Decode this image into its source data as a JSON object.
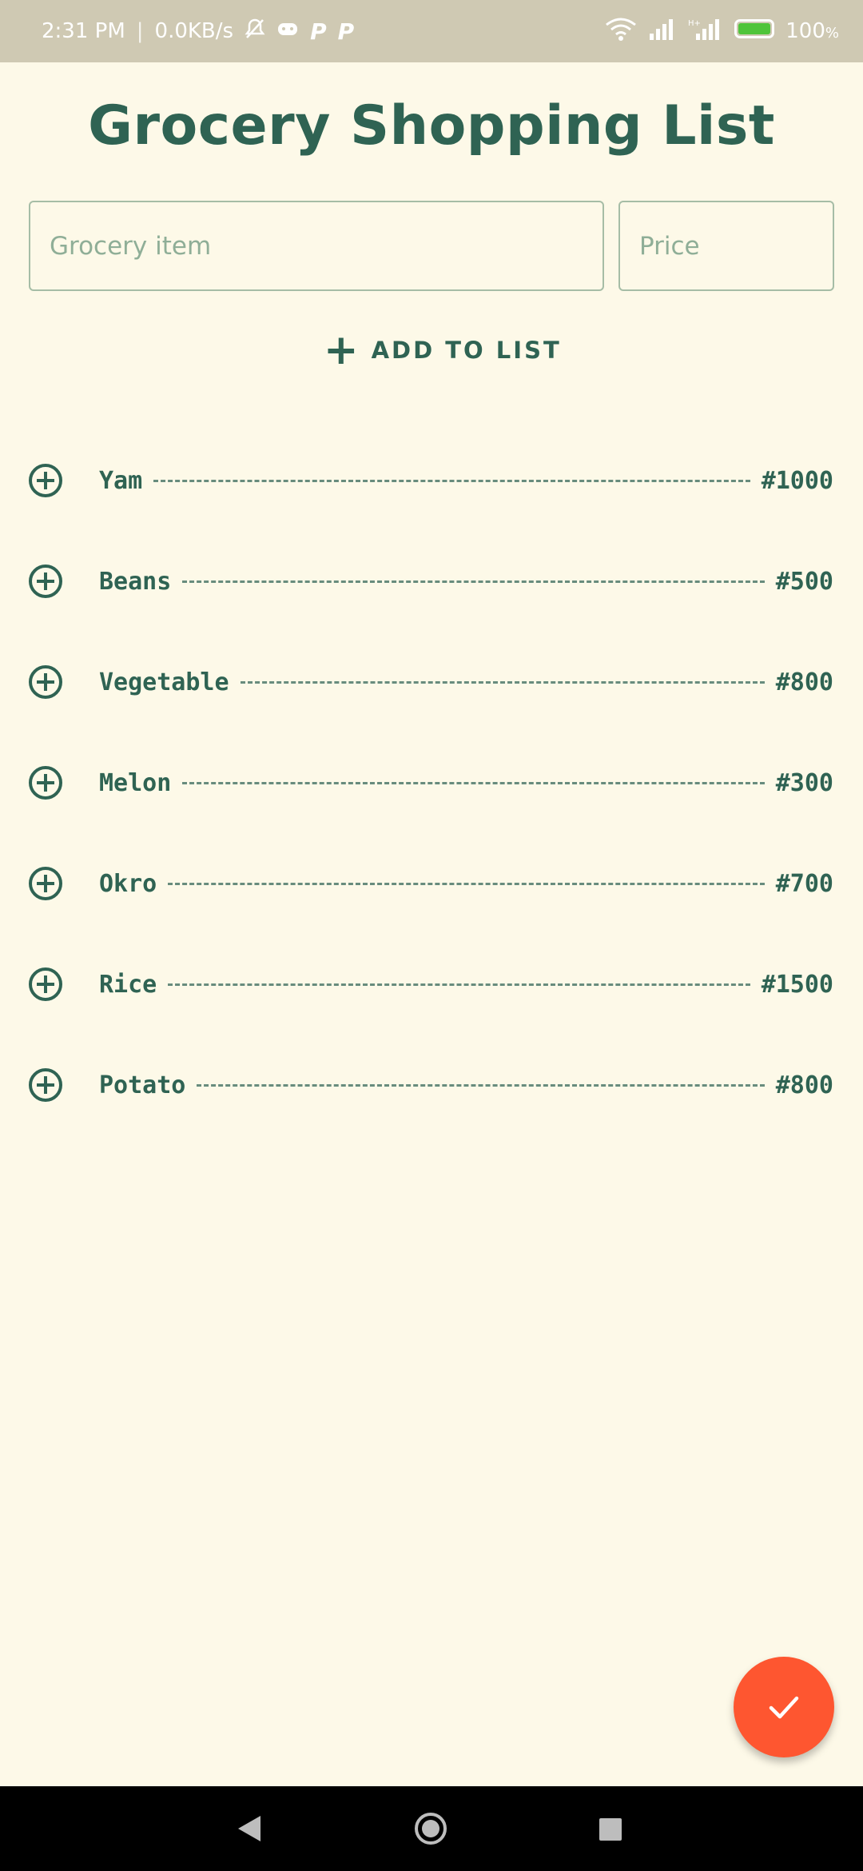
{
  "status_bar": {
    "time": "2:31 PM",
    "separator": "|",
    "network_speed": "0.0KB/s",
    "battery": "100",
    "battery_unit": "%",
    "icons": [
      "bell-off-icon",
      "game-icon",
      "p-icon",
      "p-icon",
      "wifi-icon",
      "signal-icon",
      "signal-icon",
      "battery-charging-icon"
    ]
  },
  "header": {
    "title": "Grocery Shopping List"
  },
  "form": {
    "item_placeholder": "Grocery item",
    "item_value": "",
    "price_placeholder": "Price",
    "price_value": "",
    "add_label": "ADD TO LIST",
    "add_icon": "plus-icon"
  },
  "items": [
    {
      "name": "Yam",
      "price": "#1000"
    },
    {
      "name": "Beans",
      "price": "#500"
    },
    {
      "name": "Vegetable",
      "price": "#800"
    },
    {
      "name": "Melon",
      "price": "#300"
    },
    {
      "name": "Okro",
      "price": "#700"
    },
    {
      "name": "Rice",
      "price": "#1500"
    },
    {
      "name": "Potato",
      "price": "#800"
    }
  ],
  "fab": {
    "icon": "check-icon"
  },
  "nav": {
    "icons": [
      "back-icon",
      "home-icon",
      "recents-icon"
    ]
  },
  "colors": {
    "background": "#fdf9e8",
    "primary": "#2f6353",
    "accent": "#fe5630",
    "status_bar": "#cfc9b3"
  }
}
